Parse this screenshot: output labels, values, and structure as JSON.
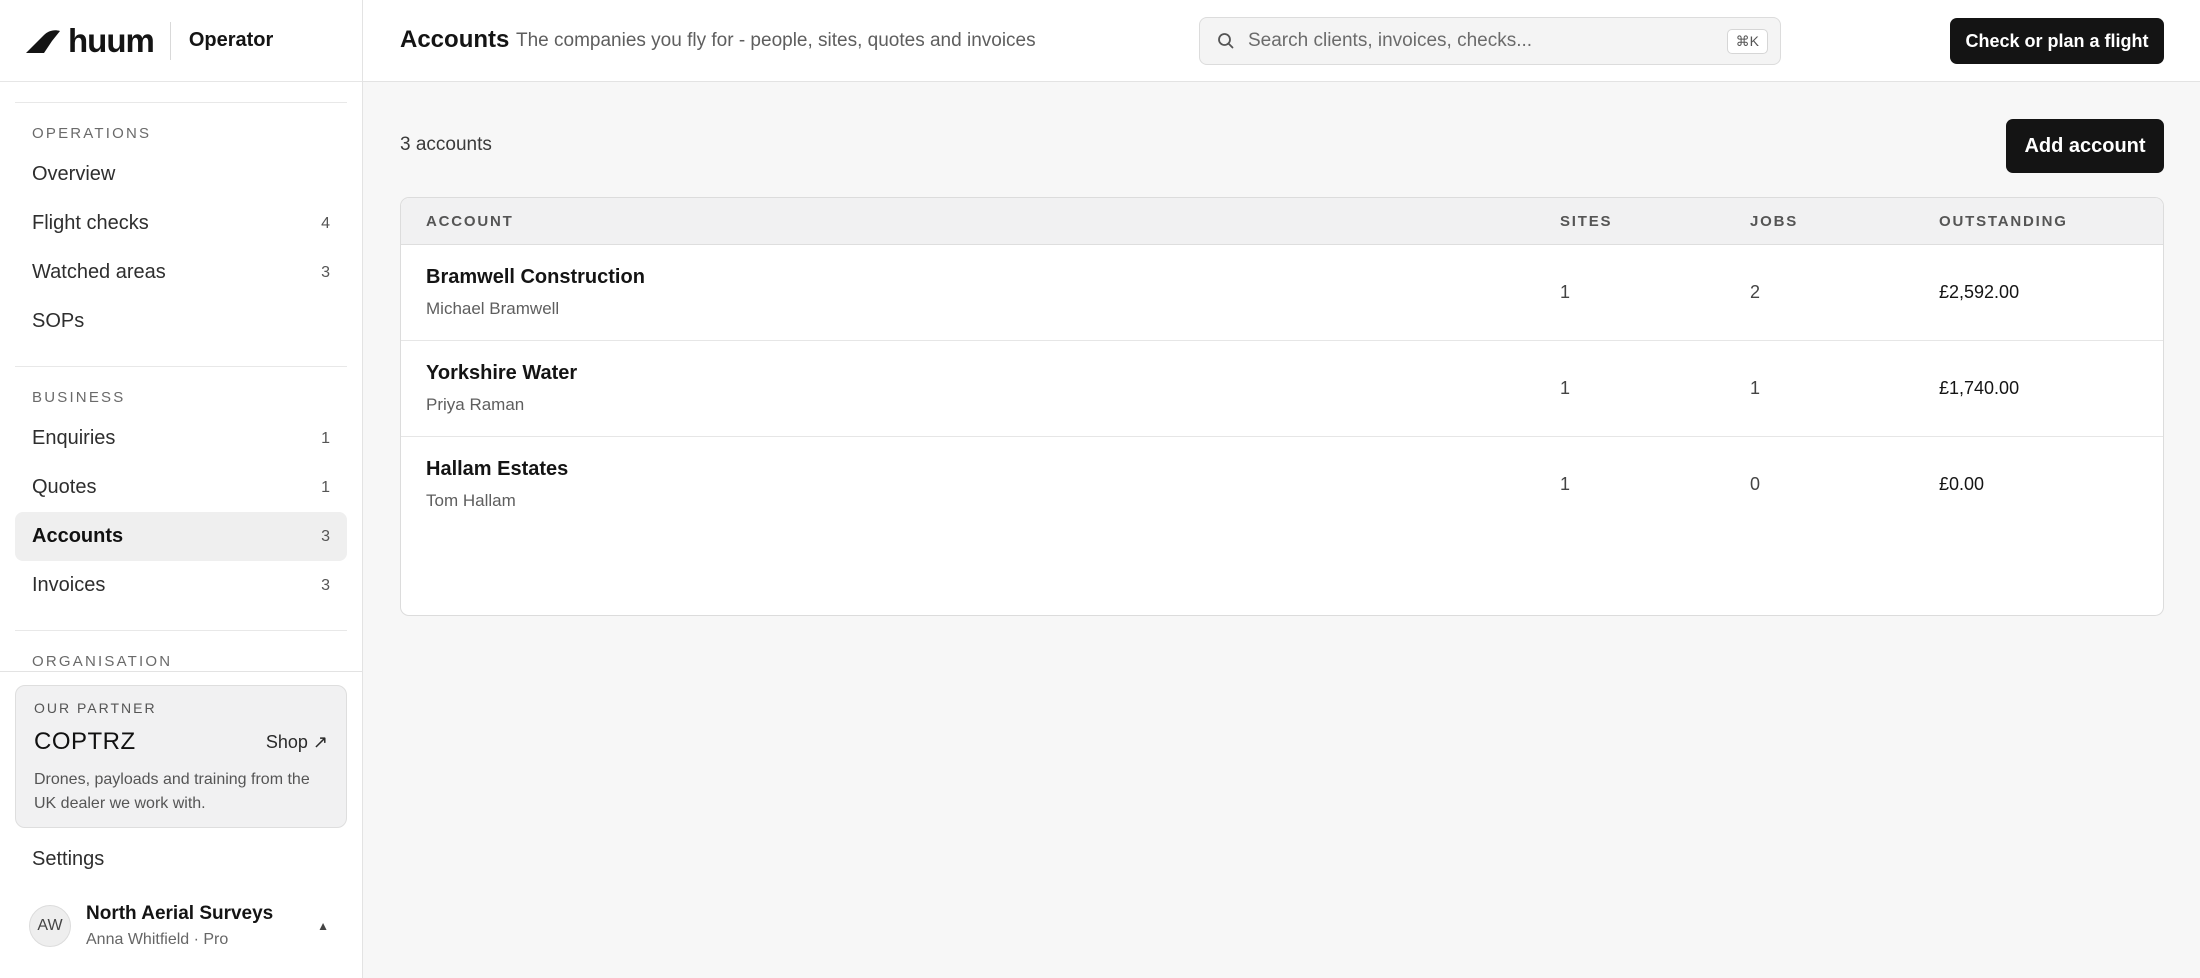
{
  "brand": {
    "name": "huum",
    "role": "Operator"
  },
  "sidebar": {
    "sections": [
      {
        "heading": "OPERATIONS",
        "items": [
          {
            "label": "Overview",
            "count": ""
          },
          {
            "label": "Flight checks",
            "count": "4"
          },
          {
            "label": "Watched areas",
            "count": "3"
          },
          {
            "label": "SOPs",
            "count": ""
          }
        ]
      },
      {
        "heading": "BUSINESS",
        "items": [
          {
            "label": "Enquiries",
            "count": "1"
          },
          {
            "label": "Quotes",
            "count": "1"
          },
          {
            "label": "Accounts",
            "count": "3",
            "active": true
          },
          {
            "label": "Invoices",
            "count": "3"
          }
        ]
      },
      {
        "heading": "ORGANISATION",
        "items": []
      }
    ],
    "partner": {
      "kicker": "OUR PARTNER",
      "name": "COPTRZ",
      "shop": "Shop ↗",
      "description": "Drones, payloads and training from the UK dealer we work with."
    },
    "settings_label": "Settings",
    "account": {
      "initials": "AW",
      "org": "North Aerial Surveys",
      "user": "Anna Whitfield · Pro",
      "caret": "▲"
    }
  },
  "header": {
    "title": "Accounts",
    "subtitle": "The companies you fly for - people, sites, quotes and invoices",
    "search": {
      "placeholder": "Search clients, invoices, checks...",
      "shortcut": "⌘K"
    },
    "primary_action": "Check or plan a flight"
  },
  "main": {
    "count_label": "3 accounts",
    "add_label": "Add account",
    "table": {
      "columns": [
        "ACCOUNT",
        "SITES",
        "JOBS",
        "OUTSTANDING"
      ],
      "rows": [
        {
          "name": "Bramwell Construction",
          "contact": "Michael Bramwell",
          "sites": "1",
          "jobs": "2",
          "outstanding": "£2,592.00"
        },
        {
          "name": "Yorkshire Water",
          "contact": "Priya Raman",
          "sites": "1",
          "jobs": "1",
          "outstanding": "£1,740.00"
        },
        {
          "name": "Hallam Estates",
          "contact": "Tom Hallam",
          "sites": "1",
          "jobs": "0",
          "outstanding": "£0.00"
        }
      ]
    }
  },
  "colors": {
    "primary": "#141414",
    "active_bg": "#efefef",
    "page_bg": "#f7f7f7"
  }
}
